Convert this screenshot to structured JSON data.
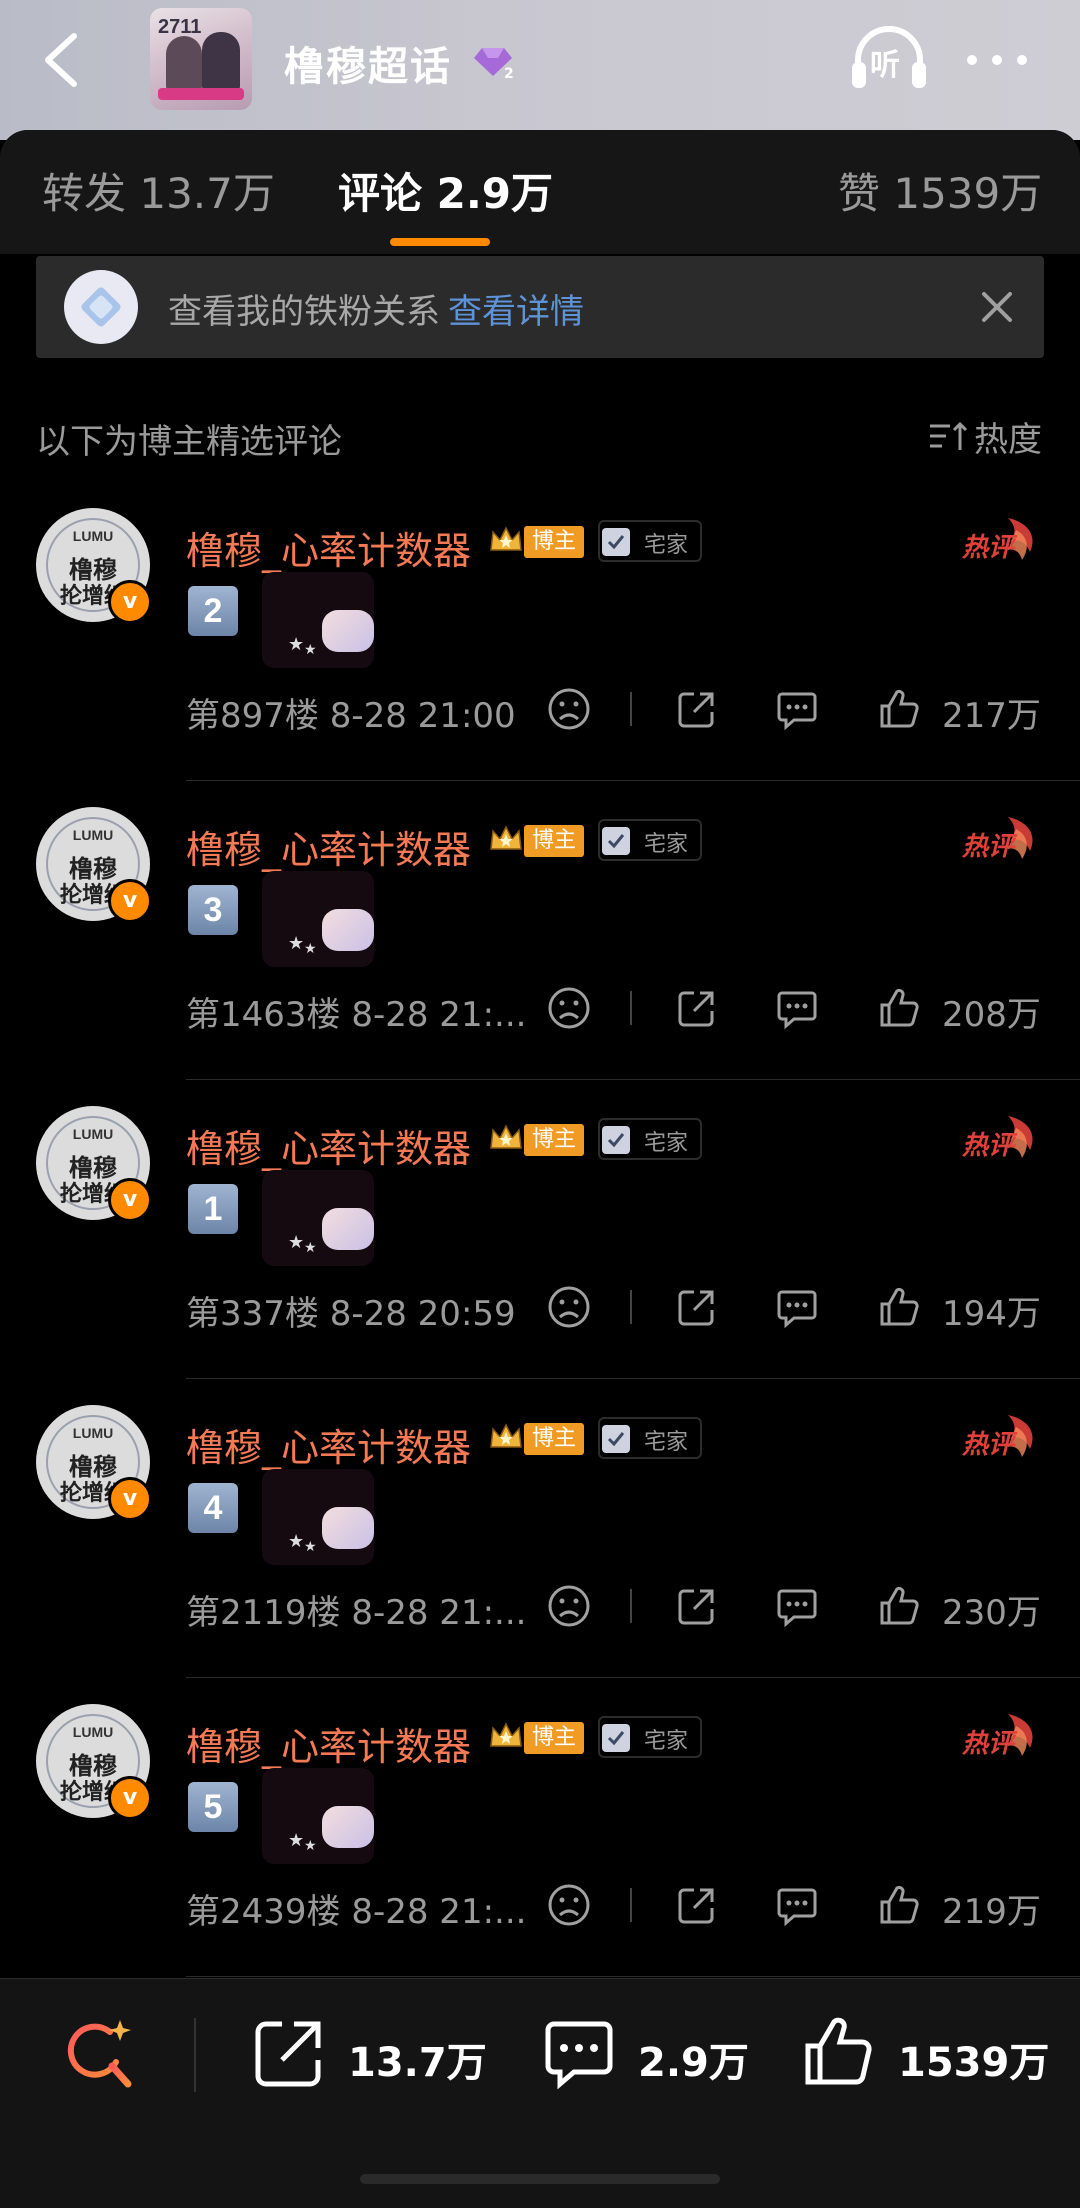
{
  "header": {
    "cover_number": "2711",
    "title": "橹穆超话",
    "level": "2",
    "listen_label": "听"
  },
  "tabs": [
    {
      "label": "转发 13.7万"
    },
    {
      "label": "评论 2.9万"
    },
    {
      "label": "赞 1539万"
    }
  ],
  "fan_banner": {
    "text": "查看我的铁粉关系",
    "link": "查看详情"
  },
  "section": {
    "title": "以下为博主精选评论",
    "sort_label": "热度"
  },
  "comment_common": {
    "avatar_lumu": "LUMU",
    "avatar_line1": "橹穆",
    "avatar_line2": "抡增织",
    "verified_mark": "v",
    "username": "橹穆_心率计数器",
    "host_tag": "博主",
    "home_tag": "宅家",
    "hot_label": "热评"
  },
  "comments": [
    {
      "number": "2",
      "meta": "第897楼  8-28 21:00",
      "likes": "217万"
    },
    {
      "number": "3",
      "meta": "第1463楼  8-28 21:...",
      "likes": "208万"
    },
    {
      "number": "1",
      "meta": "第337楼  8-28 20:59",
      "likes": "194万"
    },
    {
      "number": "4",
      "meta": "第2119楼  8-28 21:...",
      "likes": "230万"
    },
    {
      "number": "5",
      "meta": "第2439楼  8-28 21:...",
      "likes": "219万"
    }
  ],
  "bottom_bar": {
    "repost_count": "13.7万",
    "comment_count": "2.9万",
    "like_count": "1539万"
  },
  "colors": {
    "accent_orange": "#ff8a00",
    "username": "#f47a55",
    "link_blue": "#5e93d8",
    "hot_red": "#e0413b"
  }
}
